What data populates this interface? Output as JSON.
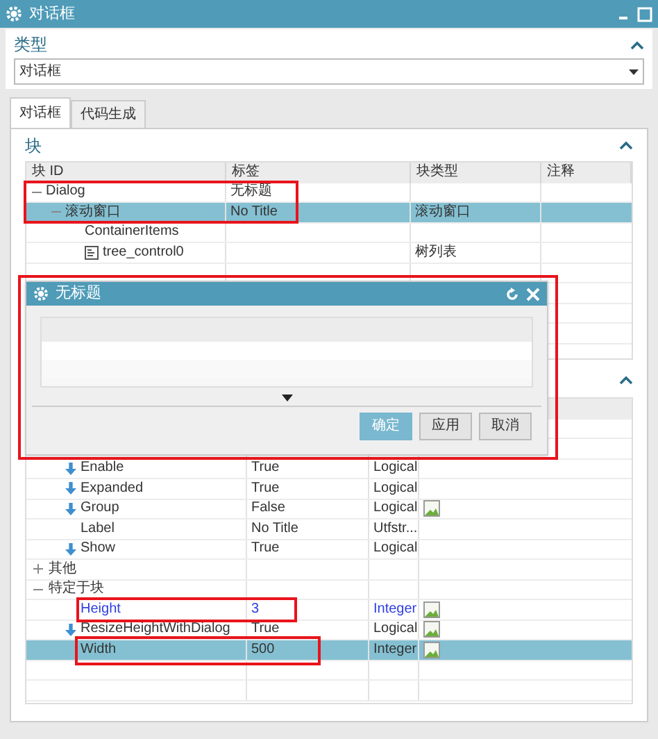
{
  "window": {
    "title": "对话框"
  },
  "type_section": {
    "title": "类型",
    "value": "对话框"
  },
  "tabs": [
    {
      "label": "对话框",
      "selected": true
    },
    {
      "label": "代码生成",
      "selected": false
    }
  ],
  "block_section": {
    "title": "块",
    "columns": [
      "块 ID",
      "标签",
      "块类型",
      "注释"
    ],
    "rows": [
      {
        "id": "Dialog",
        "label": "无标题",
        "expanded": true,
        "selected": false,
        "children": [
          {
            "id": "滚动窗口",
            "label": "No Title",
            "type": "滚动窗口",
            "expanded": true,
            "selected": true,
            "children": [
              {
                "id": "ContainerItems",
                "selected": false
              },
              {
                "id": "tree_control0",
                "type": "树列表",
                "icon": true,
                "selected": false
              }
            ]
          }
        ]
      }
    ]
  },
  "properties": {
    "groups": [
      {
        "children": [
          {
            "name": "Enable",
            "value": "True",
            "type": "Logical",
            "inherited": true,
            "editable": false,
            "modified": false,
            "selected": false
          },
          {
            "name": "Expanded",
            "value": "True",
            "type": "Logical",
            "inherited": true,
            "editable": false,
            "modified": false,
            "selected": false
          },
          {
            "name": "Group",
            "value": "False",
            "type": "Logical",
            "inherited": true,
            "editable": true,
            "modified": false,
            "selected": false
          },
          {
            "name": "Label",
            "value": "No Title",
            "type": "Utfstr...",
            "inherited": false,
            "editable": false,
            "modified": false,
            "selected": false
          },
          {
            "name": "Show",
            "value": "True",
            "type": "Logical",
            "inherited": true,
            "editable": false,
            "modified": false,
            "selected": false
          }
        ]
      },
      {
        "label": "其他",
        "expanded": false
      },
      {
        "label": "特定于块",
        "expanded": true,
        "children": [
          {
            "name": "Height",
            "value": "3",
            "type": "Integer",
            "inherited": false,
            "editable": true,
            "modified": true,
            "selected": false
          },
          {
            "name": "ResizeHeightWithDialog",
            "value": "True",
            "type": "Logical",
            "inherited": true,
            "editable": true,
            "modified": false,
            "selected": false
          },
          {
            "name": "Width",
            "value": "500",
            "type": "Integer",
            "inherited": false,
            "editable": true,
            "modified": false,
            "selected": true
          }
        ]
      }
    ]
  },
  "dialog": {
    "title": "无标题",
    "buttons": [
      {
        "label": "确定",
        "default": true
      },
      {
        "label": "应用",
        "default": false
      },
      {
        "label": "取消",
        "default": false
      }
    ]
  }
}
